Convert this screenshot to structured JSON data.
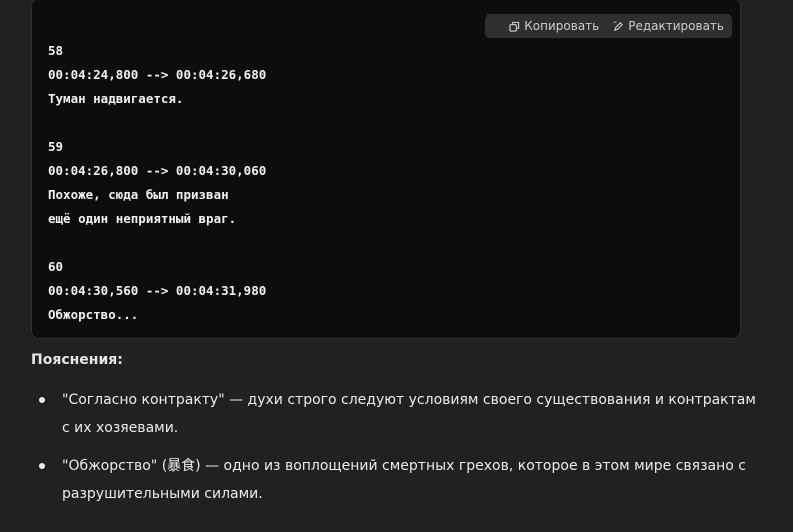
{
  "code_block": {
    "copy_label": "Копировать",
    "edit_label": "Редактировать",
    "lines": [
      "58",
      "00:04:24,800 --> 00:04:26,680",
      "Туман надвигается.",
      "",
      "59",
      "00:04:26,800 --> 00:04:30,060",
      "Похоже, сюда был призван",
      "ещё один неприятный враг.",
      "",
      "60",
      "00:04:30,560 --> 00:04:31,980",
      "Обжорство..."
    ]
  },
  "notes": {
    "heading": "Пояснения:",
    "items": [
      "\"Согласно контракту\" — духи строго следуют условиям своего существования и контрактам с их хозяевами.",
      "\"Обжорство\" (暴食) — одно из воплощений смертных грехов, которое в этом мире связано с разрушительными силами."
    ]
  }
}
